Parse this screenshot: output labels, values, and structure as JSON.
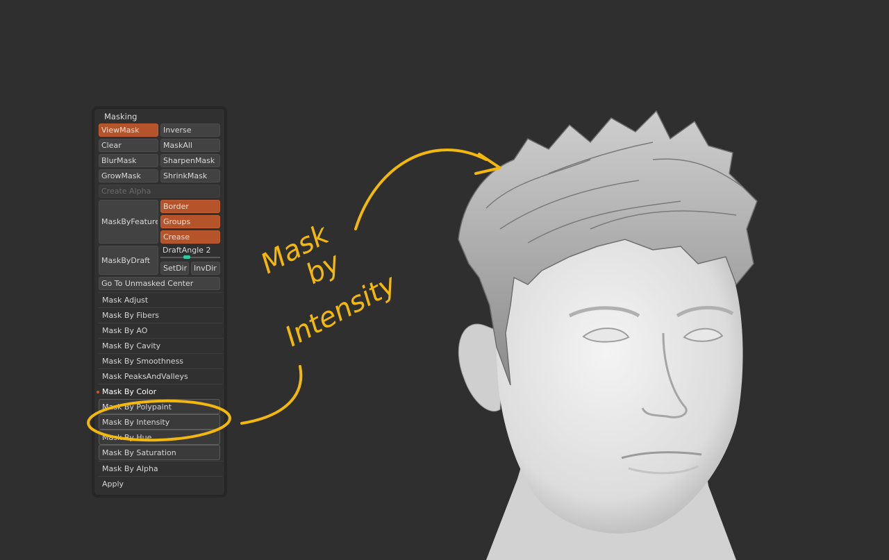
{
  "panel": {
    "title": "Masking",
    "buttons": {
      "viewmask": "ViewMask",
      "inverse": "Inverse",
      "clear": "Clear",
      "maskall": "MaskAll",
      "blurmask": "BlurMask",
      "sharpenmask": "SharpenMask",
      "growmask": "GrowMask",
      "shrinkmask": "ShrinkMask",
      "create_alpha": "Create Alpha",
      "maskbyfeature": "MaskByFeature",
      "border": "Border",
      "groups": "Groups",
      "crease": "Crease",
      "maskbydraft": "MaskByDraft",
      "draftangle_label": "DraftAngle",
      "draftangle_value": "2",
      "setdir": "SetDir",
      "invdir": "InvDir",
      "goto_center": "Go To Unmasked Center"
    },
    "subpalettes": [
      "Mask Adjust",
      "Mask By Fibers",
      "Mask By AO",
      "Mask By Cavity",
      "Mask By Smoothness",
      "Mask PeaksAndValleys",
      "Mask By Color"
    ],
    "color_options": {
      "polypaint": "Mask By Polypaint",
      "intensity": "Mask By Intensity",
      "hue": "Mask By Hue",
      "saturation": "Mask By Saturation"
    },
    "alpha": "Mask By Alpha",
    "apply": "Apply"
  },
  "annotation": {
    "line1": "Mask",
    "line2": "by",
    "line3": "Intensity",
    "color": "#f3b80e"
  },
  "colors": {
    "background": "#2f2f2f",
    "active_button": "#b5532b",
    "slider_knob": "#2fc9a2"
  }
}
